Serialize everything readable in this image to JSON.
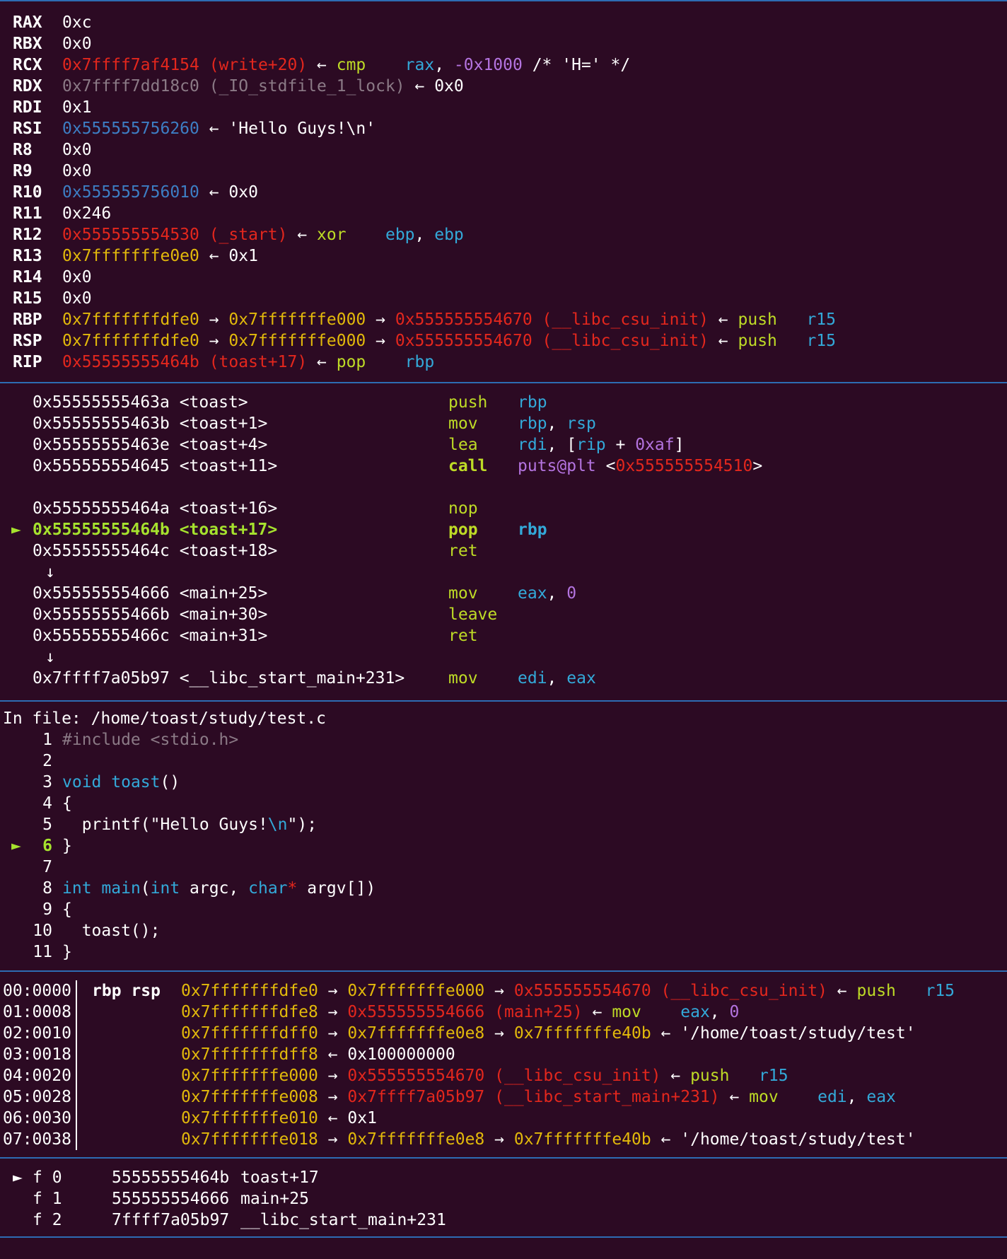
{
  "registers": [
    {
      "name": "RAX",
      "parts": [
        {
          "t": "0xc",
          "c": "w"
        }
      ]
    },
    {
      "name": "RBX",
      "parts": [
        {
          "t": "0x0",
          "c": "w"
        }
      ]
    },
    {
      "name": "RCX",
      "parts": [
        {
          "t": "0x7ffff7af4154 (write+20)",
          "c": "red"
        },
        {
          "t": " ← ",
          "c": "arrow"
        },
        {
          "t": "cmp    ",
          "c": "grn"
        },
        {
          "t": "rax",
          "c": "cyn"
        },
        {
          "t": ", ",
          "c": "w"
        },
        {
          "t": "-0x1000",
          "c": "pur"
        },
        {
          "t": " /* 'H=' */",
          "c": "w"
        }
      ]
    },
    {
      "name": "RDX",
      "parts": [
        {
          "t": "0x7ffff7dd18c0 (_IO_stdfile_1_lock)",
          "c": "gry"
        },
        {
          "t": " ← ",
          "c": "arrow"
        },
        {
          "t": "0x0",
          "c": "w"
        }
      ]
    },
    {
      "name": "RDI",
      "parts": [
        {
          "t": "0x1",
          "c": "w"
        }
      ]
    },
    {
      "name": "RSI",
      "parts": [
        {
          "t": "0x555555756260",
          "c": "blu"
        },
        {
          "t": " ← ",
          "c": "arrow"
        },
        {
          "t": "'Hello Guys!\\n'",
          "c": "w"
        }
      ]
    },
    {
      "name": "R8",
      "parts": [
        {
          "t": "0x0",
          "c": "w"
        }
      ]
    },
    {
      "name": "R9",
      "parts": [
        {
          "t": "0x0",
          "c": "w"
        }
      ]
    },
    {
      "name": "R10",
      "parts": [
        {
          "t": "0x555555756010",
          "c": "blu"
        },
        {
          "t": " ← ",
          "c": "arrow"
        },
        {
          "t": "0x0",
          "c": "w"
        }
      ]
    },
    {
      "name": "R11",
      "parts": [
        {
          "t": "0x246",
          "c": "w"
        }
      ]
    },
    {
      "name": "R12",
      "parts": [
        {
          "t": "0x555555554530 (_start)",
          "c": "red"
        },
        {
          "t": " ← ",
          "c": "arrow"
        },
        {
          "t": "xor    ",
          "c": "grn"
        },
        {
          "t": "ebp",
          "c": "cyn"
        },
        {
          "t": ", ",
          "c": "w"
        },
        {
          "t": "ebp",
          "c": "cyn"
        }
      ]
    },
    {
      "name": "R13",
      "parts": [
        {
          "t": "0x7fffffffe0e0",
          "c": "yel"
        },
        {
          "t": " ← ",
          "c": "arrow"
        },
        {
          "t": "0x1",
          "c": "w"
        }
      ]
    },
    {
      "name": "R14",
      "parts": [
        {
          "t": "0x0",
          "c": "w"
        }
      ]
    },
    {
      "name": "R15",
      "parts": [
        {
          "t": "0x0",
          "c": "w"
        }
      ]
    },
    {
      "name": "RBP",
      "parts": [
        {
          "t": "0x7fffffffdfe0",
          "c": "yel"
        },
        {
          "t": " → ",
          "c": "arrow"
        },
        {
          "t": "0x7fffffffe000",
          "c": "yel"
        },
        {
          "t": " → ",
          "c": "arrow"
        },
        {
          "t": "0x555555554670 (__libc_csu_init)",
          "c": "red"
        },
        {
          "t": " ← ",
          "c": "arrow"
        },
        {
          "t": "push   ",
          "c": "grn"
        },
        {
          "t": "r15",
          "c": "cyn"
        }
      ]
    },
    {
      "name": "RSP",
      "parts": [
        {
          "t": "0x7fffffffdfe0",
          "c": "yel"
        },
        {
          "t": " → ",
          "c": "arrow"
        },
        {
          "t": "0x7fffffffe000",
          "c": "yel"
        },
        {
          "t": " → ",
          "c": "arrow"
        },
        {
          "t": "0x555555554670 (__libc_csu_init)",
          "c": "red"
        },
        {
          "t": " ← ",
          "c": "arrow"
        },
        {
          "t": "push   ",
          "c": "grn"
        },
        {
          "t": "r15",
          "c": "cyn"
        }
      ]
    },
    {
      "name": "RIP",
      "parts": [
        {
          "t": "0x55555555464b (toast+17)",
          "c": "red"
        },
        {
          "t": " ← ",
          "c": "arrow"
        },
        {
          "t": "pop    ",
          "c": "grn"
        },
        {
          "t": "rbp",
          "c": "cyn"
        }
      ]
    }
  ],
  "disasm": [
    {
      "row": 0,
      "addr": "0x55555555463a <toast>",
      "mn": "push",
      "ops": [
        {
          "t": "rbp",
          "c": "cyn"
        }
      ]
    },
    {
      "row": 1,
      "addr": "0x55555555463b <toast+1>",
      "mn": "mov",
      "ops": [
        {
          "t": "rbp",
          "c": "cyn"
        },
        {
          "t": ", ",
          "c": "w"
        },
        {
          "t": "rsp",
          "c": "cyn"
        }
      ]
    },
    {
      "row": 2,
      "addr": "0x55555555463e <toast+4>",
      "mn": "lea",
      "ops": [
        {
          "t": "rdi",
          "c": "cyn"
        },
        {
          "t": ", [",
          "c": "w"
        },
        {
          "t": "rip",
          "c": "cyn"
        },
        {
          "t": " + ",
          "c": "w"
        },
        {
          "t": "0xaf",
          "c": "pur"
        },
        {
          "t": "]",
          "c": "w"
        }
      ]
    },
    {
      "row": 3,
      "addr": "0x555555554645 <toast+11>",
      "mn": "call",
      "bold": true,
      "ops": [
        {
          "t": "puts@plt",
          "c": "pur"
        },
        {
          "t": " <",
          "c": "w"
        },
        {
          "t": "0x555555554510",
          "c": "red"
        },
        {
          "t": ">",
          "c": "w"
        }
      ]
    },
    {
      "row": 5,
      "addr": "0x55555555464a <toast+16>",
      "mn": "nop",
      "ops": []
    },
    {
      "row": 6,
      "addr": "0x55555555464b <toast+17>",
      "mn": "pop",
      "current": true,
      "ops": [
        {
          "t": "rbp",
          "c": "cyn"
        }
      ]
    },
    {
      "row": 7,
      "addr": "0x55555555464c <toast+18>",
      "mn": "ret",
      "ops": []
    },
    {
      "row": 8,
      "down": "↓"
    },
    {
      "row": 9,
      "addr": "0x555555554666 <main+25>",
      "mn": "mov",
      "ops": [
        {
          "t": "eax",
          "c": "cyn"
        },
        {
          "t": ", ",
          "c": "w"
        },
        {
          "t": "0",
          "c": "pur"
        }
      ]
    },
    {
      "row": 10,
      "addr": "0x55555555466b <main+30>",
      "mn": "leave",
      "ops": []
    },
    {
      "row": 11,
      "addr": "0x55555555466c <main+31>",
      "mn": "ret",
      "ops": []
    },
    {
      "row": 12,
      "down": "↓"
    },
    {
      "row": 13,
      "addr": "0x7ffff7a05b97 <__libc_start_main+231>",
      "mn": "mov",
      "ops": [
        {
          "t": "edi",
          "c": "cyn"
        },
        {
          "t": ", ",
          "c": "w"
        },
        {
          "t": "eax",
          "c": "cyn"
        }
      ]
    }
  ],
  "marker_glyph": "►",
  "source": {
    "header": "In file: /home/toast/study/test.c",
    "lines": [
      {
        "n": "1",
        "parts": [
          {
            "t": "#include <stdio.h>",
            "c": "gry"
          }
        ]
      },
      {
        "n": "2",
        "parts": []
      },
      {
        "n": "3",
        "parts": [
          {
            "t": "void",
            "c": "cyn"
          },
          {
            "t": " ",
            "c": "w"
          },
          {
            "t": "toast",
            "c": "cyn"
          },
          {
            "t": "()",
            "c": "w"
          }
        ]
      },
      {
        "n": "4",
        "parts": [
          {
            "t": "{",
            "c": "w"
          }
        ]
      },
      {
        "n": "5",
        "parts": [
          {
            "t": "  printf(\"Hello Guys!",
            "c": "w"
          },
          {
            "t": "\\n",
            "c": "cyn"
          },
          {
            "t": "\");",
            "c": "w"
          }
        ]
      },
      {
        "n": "6",
        "current": true,
        "parts": [
          {
            "t": "}",
            "c": "w"
          }
        ]
      },
      {
        "n": "7",
        "parts": []
      },
      {
        "n": "8",
        "parts": [
          {
            "t": "int",
            "c": "cyn"
          },
          {
            "t": " ",
            "c": "w"
          },
          {
            "t": "main",
            "c": "cyn"
          },
          {
            "t": "(",
            "c": "w"
          },
          {
            "t": "int",
            "c": "cyn"
          },
          {
            "t": " argc, ",
            "c": "w"
          },
          {
            "t": "char",
            "c": "cyn"
          },
          {
            "t": "*",
            "c": "red"
          },
          {
            "t": " argv[])",
            "c": "w"
          }
        ]
      },
      {
        "n": "9",
        "parts": [
          {
            "t": "{",
            "c": "w"
          }
        ]
      },
      {
        "n": "10",
        "parts": [
          {
            "t": "  toast();",
            "c": "w"
          }
        ]
      },
      {
        "n": "11",
        "parts": [
          {
            "t": "}",
            "c": "w"
          }
        ]
      }
    ]
  },
  "stack": [
    {
      "off": "00:0000",
      "label": "rbp rsp",
      "parts": [
        {
          "t": "0x7fffffffdfe0",
          "c": "yel"
        },
        {
          "t": " → ",
          "c": "arrow"
        },
        {
          "t": "0x7fffffffe000",
          "c": "yel"
        },
        {
          "t": " → ",
          "c": "arrow"
        },
        {
          "t": "0x555555554670 (__libc_csu_init)",
          "c": "red"
        },
        {
          "t": " ← ",
          "c": "arrow"
        },
        {
          "t": "push   ",
          "c": "grn"
        },
        {
          "t": "r15",
          "c": "cyn"
        }
      ]
    },
    {
      "off": "01:0008",
      "label": "",
      "parts": [
        {
          "t": "0x7fffffffdfe8",
          "c": "yel"
        },
        {
          "t": " → ",
          "c": "arrow"
        },
        {
          "t": "0x555555554666 (main+25)",
          "c": "red"
        },
        {
          "t": " ← ",
          "c": "arrow"
        },
        {
          "t": "mov    ",
          "c": "grn"
        },
        {
          "t": "eax",
          "c": "cyn"
        },
        {
          "t": ", ",
          "c": "w"
        },
        {
          "t": "0",
          "c": "pur"
        }
      ]
    },
    {
      "off": "02:0010",
      "label": "",
      "parts": [
        {
          "t": "0x7fffffffdff0",
          "c": "yel"
        },
        {
          "t": " → ",
          "c": "arrow"
        },
        {
          "t": "0x7fffffffe0e8",
          "c": "yel"
        },
        {
          "t": " → ",
          "c": "arrow"
        },
        {
          "t": "0x7fffffffe40b",
          "c": "yel"
        },
        {
          "t": " ← ",
          "c": "arrow"
        },
        {
          "t": "'/home/toast/study/test'",
          "c": "w"
        }
      ]
    },
    {
      "off": "03:0018",
      "label": "",
      "parts": [
        {
          "t": "0x7fffffffdff8",
          "c": "yel"
        },
        {
          "t": " ← ",
          "c": "arrow"
        },
        {
          "t": "0x100000000",
          "c": "w"
        }
      ]
    },
    {
      "off": "04:0020",
      "label": "",
      "parts": [
        {
          "t": "0x7fffffffe000",
          "c": "yel"
        },
        {
          "t": " → ",
          "c": "arrow"
        },
        {
          "t": "0x555555554670 (__libc_csu_init)",
          "c": "red"
        },
        {
          "t": " ← ",
          "c": "arrow"
        },
        {
          "t": "push   ",
          "c": "grn"
        },
        {
          "t": "r15",
          "c": "cyn"
        }
      ]
    },
    {
      "off": "05:0028",
      "label": "",
      "parts": [
        {
          "t": "0x7fffffffe008",
          "c": "yel"
        },
        {
          "t": " → ",
          "c": "arrow"
        },
        {
          "t": "0x7ffff7a05b97 (__libc_start_main+231)",
          "c": "red"
        },
        {
          "t": " ← ",
          "c": "arrow"
        },
        {
          "t": "mov    ",
          "c": "grn"
        },
        {
          "t": "edi",
          "c": "cyn"
        },
        {
          "t": ", ",
          "c": "w"
        },
        {
          "t": "eax",
          "c": "cyn"
        }
      ]
    },
    {
      "off": "06:0030",
      "label": "",
      "parts": [
        {
          "t": "0x7fffffffe010",
          "c": "yel"
        },
        {
          "t": " ← ",
          "c": "arrow"
        },
        {
          "t": "0x1",
          "c": "w"
        }
      ]
    },
    {
      "off": "07:0038",
      "label": "",
      "parts": [
        {
          "t": "0x7fffffffe018",
          "c": "yel"
        },
        {
          "t": " → ",
          "c": "arrow"
        },
        {
          "t": "0x7fffffffe0e8",
          "c": "yel"
        },
        {
          "t": " → ",
          "c": "arrow"
        },
        {
          "t": "0x7fffffffe40b",
          "c": "yel"
        },
        {
          "t": " ← ",
          "c": "arrow"
        },
        {
          "t": "'/home/toast/study/test'",
          "c": "w"
        }
      ]
    }
  ],
  "backtrace": [
    {
      "frame": "f 0",
      "addr": "55555555464b",
      "sym": "toast+17",
      "current": true
    },
    {
      "frame": "f 1",
      "addr": "555555554666",
      "sym": "main+25"
    },
    {
      "frame": "f 2",
      "addr": "7ffff7a05b97",
      "sym": "__libc_start_main+231"
    }
  ]
}
